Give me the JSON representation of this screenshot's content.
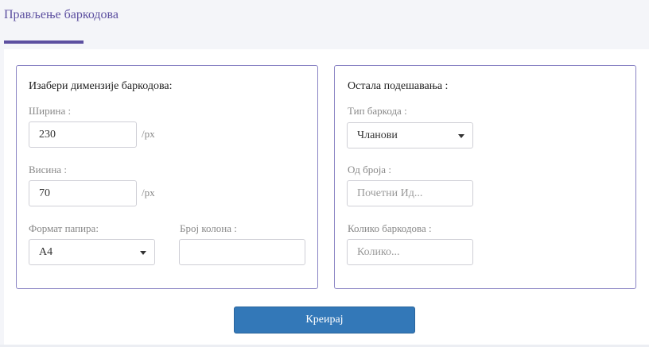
{
  "tab": {
    "title": "Прављење баркодова"
  },
  "left_panel": {
    "title": "Изабери димензије баркодова:",
    "width": {
      "label": "Ширина :",
      "value": "230",
      "unit": "/px"
    },
    "height": {
      "label": "Висина :",
      "value": "70",
      "unit": "/px"
    },
    "paper_format": {
      "label": "Формат папира:",
      "selected": "A4"
    },
    "columns": {
      "label": "Број колона :",
      "value": ""
    }
  },
  "right_panel": {
    "title": "Остала подешавања :",
    "barcode_type": {
      "label": "Тип баркода :",
      "selected": "Чланови"
    },
    "from_number": {
      "label": "Од броја :",
      "placeholder": "Почетни Ид..."
    },
    "count": {
      "label": "Колико баркодова :",
      "placeholder": "Колико..."
    }
  },
  "actions": {
    "create_label": "Креирај"
  },
  "colors": {
    "accent": "#5c4fa0",
    "panel_border": "#8a84c4",
    "primary_button": "#3378b8"
  }
}
